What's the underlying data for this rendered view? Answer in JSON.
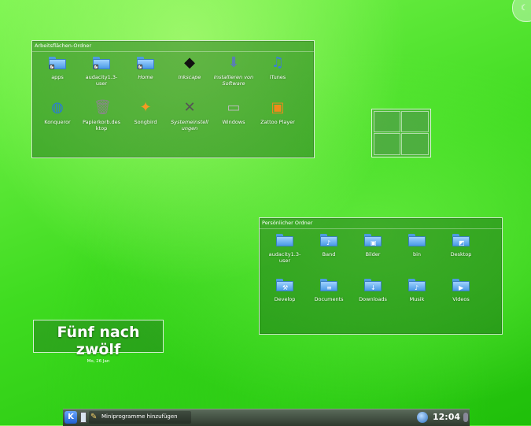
{
  "desktop_folder": {
    "title": "Arbeitsflächen-Ordner",
    "items": [
      {
        "label": "apps",
        "icon": "folder-link-icon"
      },
      {
        "label": "audacity1.3-\nuser",
        "icon": "folder-link-icon"
      },
      {
        "label": "Home",
        "icon": "folder-link-icon"
      },
      {
        "label": "Inkscape",
        "icon": "inkscape-icon"
      },
      {
        "label": "Installieren von\nSoftware",
        "icon": "install-software-icon"
      },
      {
        "label": "iTunes",
        "icon": "itunes-icon"
      },
      {
        "label": "Konqueror",
        "icon": "konqueror-icon"
      },
      {
        "label": "Papierkorb.des\nktop",
        "icon": "trash-icon"
      },
      {
        "label": "Songbird",
        "icon": "songbird-icon"
      },
      {
        "label": "Systemeinstell\nungen",
        "icon": "system-settings-icon"
      },
      {
        "label": "Windows",
        "icon": "drive-icon"
      },
      {
        "label": "Zattoo Player",
        "icon": "tv-icon"
      }
    ]
  },
  "personal_folder": {
    "title": "Persönlicher Ordner",
    "items": [
      {
        "label": "audacity1.3-\nuser",
        "icon": "folder-icon"
      },
      {
        "label": "Band",
        "icon": "music-folder-icon"
      },
      {
        "label": "Bilder",
        "icon": "pictures-folder-icon"
      },
      {
        "label": "bin",
        "icon": "folder-icon"
      },
      {
        "label": "Desktop",
        "icon": "desktop-folder-icon"
      },
      {
        "label": "Develop",
        "icon": "develop-folder-icon"
      },
      {
        "label": "Documents",
        "icon": "documents-folder-icon"
      },
      {
        "label": "Downloads",
        "icon": "downloads-folder-icon"
      },
      {
        "label": "Musik",
        "icon": "music-folder-icon"
      },
      {
        "label": "Videos",
        "icon": "videos-folder-icon"
      }
    ]
  },
  "clock": {
    "time_text": "Fünf nach zwölf",
    "date": "Mo, 26 Jan"
  },
  "taskbar": {
    "add_widgets_label": "Miniprogramme hinzufügen",
    "time": "12:04"
  },
  "colors": {
    "wallpaper": "#3fdc20",
    "folder": "#4a9ae6"
  }
}
